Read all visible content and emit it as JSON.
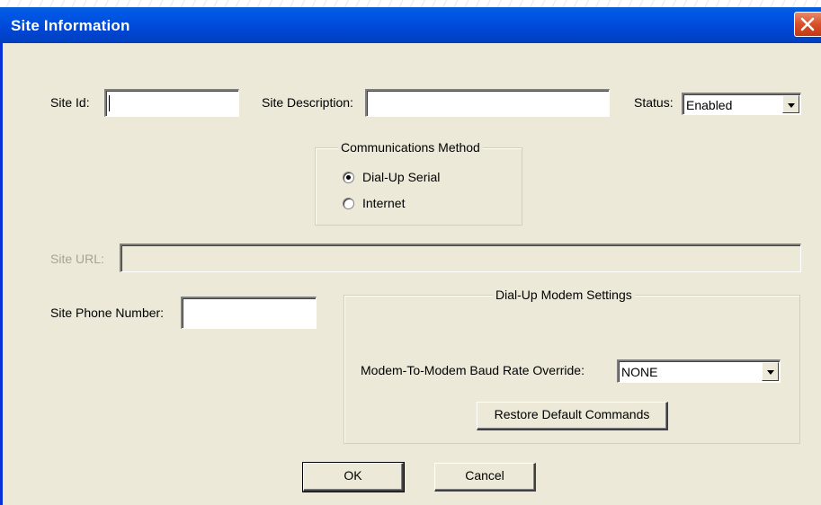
{
  "window": {
    "title": "Site Information"
  },
  "site_id": {
    "label": "Site Id:",
    "value": ""
  },
  "site_description": {
    "label": "Site Description:",
    "value": ""
  },
  "status": {
    "label": "Status:",
    "selected": "Enabled"
  },
  "comm_method": {
    "title": "Communications Method",
    "options": [
      {
        "label": "Dial-Up Serial",
        "checked": true
      },
      {
        "label": "Internet",
        "checked": false
      }
    ]
  },
  "site_url": {
    "label": "Site URL:",
    "value": "",
    "disabled": true
  },
  "site_phone": {
    "label": "Site Phone Number:",
    "value": ""
  },
  "modem_settings": {
    "title": "Dial-Up Modem Settings",
    "baud_label": "Modem-To-Modem Baud Rate Override:",
    "baud_selected": "NONE",
    "restore_button": "Restore Default Commands"
  },
  "buttons": {
    "ok": "OK",
    "cancel": "Cancel"
  },
  "colors": {
    "title_bar": "#0047d6",
    "dialog_bg": "#ece9d8",
    "close_button": "#d8502a"
  }
}
